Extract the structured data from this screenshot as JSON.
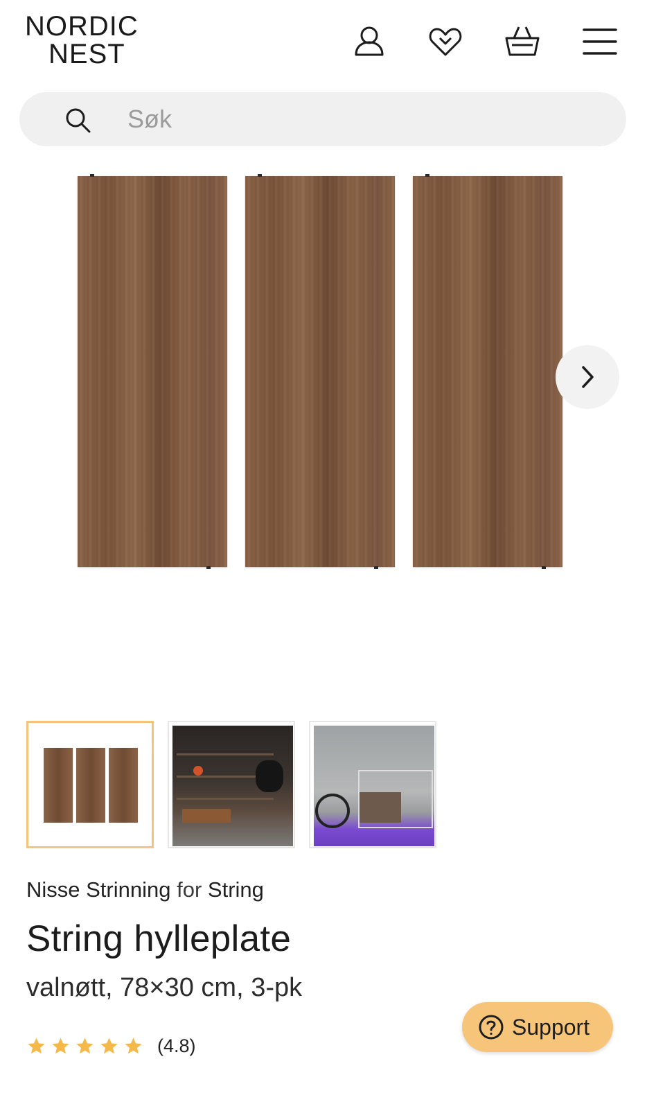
{
  "header": {
    "logo_line1": "NORDIC",
    "logo_line2": "NEST",
    "icons": [
      "user-icon",
      "heart-icon",
      "basket-icon",
      "menu-icon"
    ]
  },
  "search": {
    "placeholder": "Søk"
  },
  "gallery": {
    "next_icon": "chevron-right-icon"
  },
  "thumbnails": [
    {
      "name": "three walnut shelf boards",
      "active": true
    },
    {
      "name": "dark shelving room scene",
      "active": false
    },
    {
      "name": "shelving with bicycle scene",
      "active": false
    }
  ],
  "product": {
    "designer": "Nisse Strinning",
    "for_word": "for",
    "brand": "String",
    "title": "String hylleplate",
    "variant": "valnøtt, 78×30 cm, 3-pk",
    "rating_stars": 5,
    "rating_text": "(4.8)"
  },
  "support": {
    "label": "Support",
    "icon": "question-circle-icon"
  },
  "colors": {
    "accent": "#f6c57a",
    "active_thumb_border": "#f4c47a",
    "star": "#f5b94a",
    "search_bg": "#f0f0f0"
  }
}
